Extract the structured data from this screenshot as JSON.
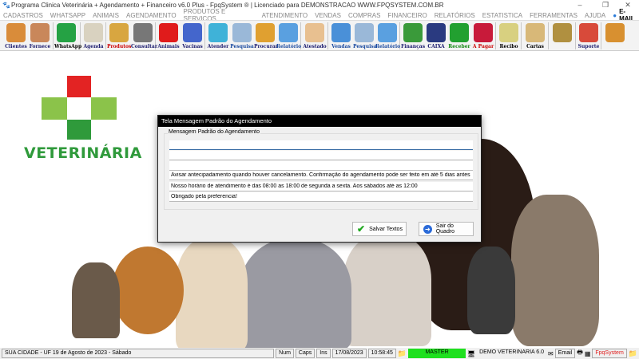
{
  "window": {
    "title": "Programa Clinica Veterinária + Agendamento + Financeiro v6.0 Plus - FpqSystem ® | Licenciado para  DEMONSTRACAO WWW.FPQSYSTEM.COM.BR",
    "minimize": "–",
    "maximize": "❐",
    "close": "✕"
  },
  "menu": [
    "CADASTROS",
    "WHATSAPP",
    "ANIMAIS",
    "AGENDAMENTO",
    "PRODUTOS E SERVIÇOS",
    "ATENDIMENTO",
    "VENDAS",
    "COMPRAS",
    "FINANCEIRO",
    "RELATÓRIOS",
    "ESTATISTICA",
    "FERRAMENTAS",
    "AJUDA"
  ],
  "menu_email": "E-MAIL",
  "toolbar": [
    {
      "label": "Clientes",
      "icon": "clients-icon",
      "color": "#d98c3a",
      "lc": "#1a1a6e"
    },
    {
      "label": "Fornece",
      "icon": "supplier-icon",
      "color": "#c9875a",
      "lc": "#1a1a6e"
    },
    {
      "label": "WhatsApp",
      "icon": "whatsapp-icon",
      "color": "#25a244",
      "lc": "#000"
    },
    {
      "label": "Agenda",
      "icon": "calendar-icon",
      "color": "#d9d2c0",
      "lc": "#1a1a6e"
    },
    {
      "label": "Produtos",
      "icon": "boxes-icon",
      "color": "#d8a640",
      "lc": "#c00"
    },
    {
      "label": "Consultar",
      "icon": "barcode-icon",
      "color": "#777",
      "lc": "#1a1a6e"
    },
    {
      "label": "Animais",
      "icon": "paw-icon",
      "color": "#e01b1b",
      "lc": "#1a1a6e"
    },
    {
      "label": "Vacinas",
      "icon": "syringe-icon",
      "color": "#4466cc",
      "lc": "#1a1a6e"
    },
    {
      "label": "Atender",
      "icon": "paw-plus-icon",
      "color": "#3fb2d8",
      "lc": "#1a1a6e"
    },
    {
      "label": "Pesquisa",
      "icon": "search-doc-icon",
      "color": "#9ab8d8",
      "lc": "#1a4aa0"
    },
    {
      "label": "Procurar",
      "icon": "folder-icon",
      "color": "#e0a030",
      "lc": "#1a1a6e"
    },
    {
      "label": "Relatório",
      "icon": "printer-icon",
      "color": "#5aa0e0",
      "lc": "#1a4aa0"
    },
    {
      "label": "Atestado",
      "icon": "certificate-icon",
      "color": "#e8c090",
      "lc": "#1a1a6e"
    },
    {
      "label": "Vendas",
      "icon": "monitor-icon",
      "color": "#4a90d8",
      "lc": "#1a4aa0"
    },
    {
      "label": "Pesquisa",
      "icon": "search-doc-icon",
      "color": "#9ab8d8",
      "lc": "#1a4aa0"
    },
    {
      "label": "Relatório",
      "icon": "printer-icon",
      "color": "#5aa0e0",
      "lc": "#1a4aa0"
    },
    {
      "label": "Finanças",
      "icon": "finance-chart-icon",
      "color": "#3a9a3a",
      "lc": "#1a1a6e"
    },
    {
      "label": "CAIXA",
      "icon": "cashbook-icon",
      "color": "#2a3a80",
      "lc": "#1a1a6e"
    },
    {
      "label": "Receber",
      "icon": "dollar-green-icon",
      "color": "#22a030",
      "lc": "#118811"
    },
    {
      "label": "A Pagar",
      "icon": "dollar-red-icon",
      "color": "#c81a3a",
      "lc": "#c00"
    },
    {
      "label": "Recibo",
      "icon": "receipt-icon",
      "color": "#d8d080",
      "lc": "#000"
    },
    {
      "label": "Cartas",
      "icon": "scroll-icon",
      "color": "#d8b878",
      "lc": "#000"
    },
    {
      "label": "",
      "icon": "coin-icon",
      "color": "#b09040",
      "lc": "#000"
    },
    {
      "label": "Suporte",
      "icon": "support-icon",
      "color": "#d84a3a",
      "lc": "#1a1a6e"
    },
    {
      "label": "",
      "icon": "exit-door-icon",
      "color": "#d89030",
      "lc": "#000"
    }
  ],
  "logo": {
    "text": "VETERINÁRIA",
    "red": "#e32323",
    "green": "#2f9a3b",
    "light_green": "#8bc34a"
  },
  "dialog": {
    "title": "Tela Mensagem Padrão do Agendamento",
    "group_label": "Mensagem Padrão do Agendamento",
    "fields": [
      "",
      "",
      "",
      "Avisar antecipadamento quando houver cancelamento. Confirmação do agendamento pode ser feito em até 5 dias antes",
      "Nosso horário de atendimento é das 08:00 as 18:00 de segunda a sexta. Aos sábados até as 12:00",
      "Obrigado pela preferencia!"
    ],
    "save_label": "Salvar Textos",
    "exit_label": "Sair do Quadro"
  },
  "status": {
    "city": "SUA CIDADE - UF 19 de Agosto de 2023 - Sábado",
    "num": "Num",
    "caps": "Caps",
    "ins": "Ins",
    "date": "17/08/2023",
    "time": "10:58:45",
    "user": "MASTER",
    "company": "DEMO VETERINARIA 6.0",
    "email": "Email",
    "brand": "FpqSystem",
    "user_color": "#1fe01f"
  }
}
